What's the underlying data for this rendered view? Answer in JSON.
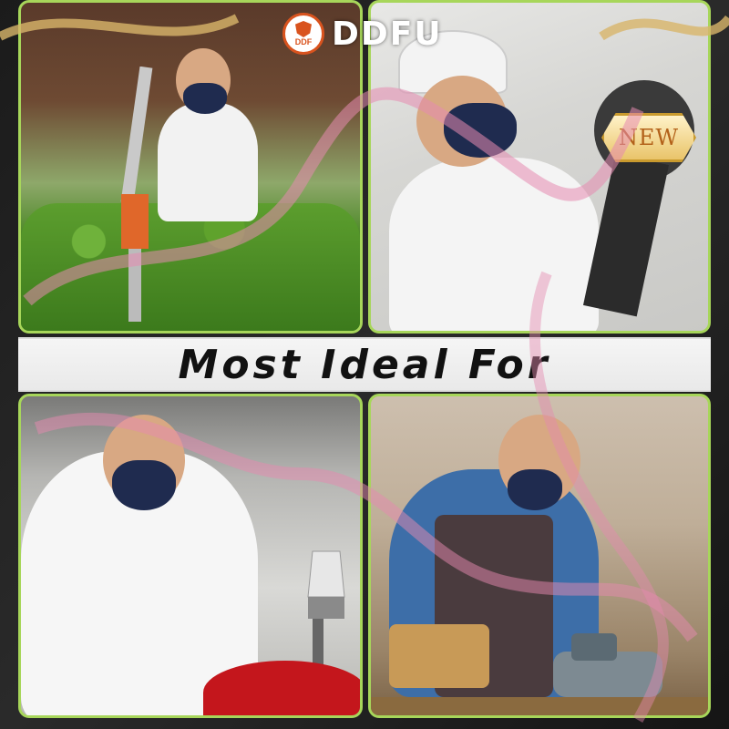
{
  "logo": {
    "badge_text": "DDF",
    "name": "DDFU"
  },
  "badge": {
    "label": "NEW"
  },
  "banner": {
    "text": "Most Ideal For"
  },
  "colors": {
    "panel_border": "#a7d65a",
    "mask": "#1f2b4f",
    "new_badge_text": "#b3621a",
    "ribbon": "#e58ab0"
  },
  "scenes": [
    {
      "id": "hedge-trimming",
      "icon": "hedge-trimmer-icon"
    },
    {
      "id": "construction-grinding",
      "icon": "angle-grinder-icon"
    },
    {
      "id": "spray-painting",
      "icon": "spray-gun-icon"
    },
    {
      "id": "woodworking-sanding",
      "icon": "belt-sander-icon"
    }
  ]
}
